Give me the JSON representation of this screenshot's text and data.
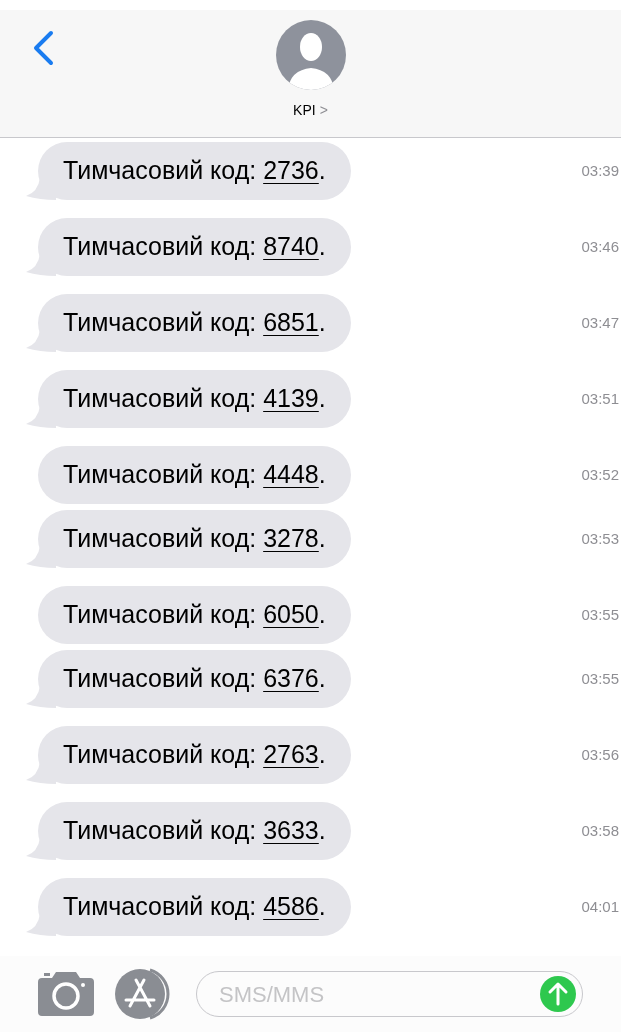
{
  "header": {
    "contact": "KPI",
    "chevron": ">"
  },
  "messages": [
    {
      "prefix": "Тимчасовий код: ",
      "code": "2736",
      "suffix": ".",
      "time": "03:39",
      "tail": true
    },
    {
      "prefix": "Тимчасовий код: ",
      "code": "8740",
      "suffix": ".",
      "time": "03:46",
      "tail": true
    },
    {
      "prefix": "Тимчасовий код: ",
      "code": "6851",
      "suffix": ".",
      "time": "03:47",
      "tail": true
    },
    {
      "prefix": "Тимчасовий код: ",
      "code": "4139",
      "suffix": ".",
      "time": "03:51",
      "tail": true
    },
    {
      "prefix": "Тимчасовий код: ",
      "code": "4448",
      "suffix": ".",
      "time": "03:52",
      "tail": false
    },
    {
      "prefix": "Тимчасовий код: ",
      "code": "3278",
      "suffix": ".",
      "time": "03:53",
      "tail": true
    },
    {
      "prefix": "Тимчасовий код: ",
      "code": "6050",
      "suffix": ".",
      "time": "03:55",
      "tail": false
    },
    {
      "prefix": "Тимчасовий код: ",
      "code": "6376",
      "suffix": ".",
      "time": "03:55",
      "tail": true
    },
    {
      "prefix": "Тимчасовий код: ",
      "code": "2763",
      "suffix": ".",
      "time": "03:56",
      "tail": true
    },
    {
      "prefix": "Тимчасовий код: ",
      "code": "3633",
      "suffix": ".",
      "time": "03:58",
      "tail": true
    },
    {
      "prefix": "Тимчасовий код: ",
      "code": "4586",
      "suffix": ".",
      "time": "04:01",
      "tail": true
    }
  ],
  "composer": {
    "placeholder": "SMS/MMS"
  }
}
